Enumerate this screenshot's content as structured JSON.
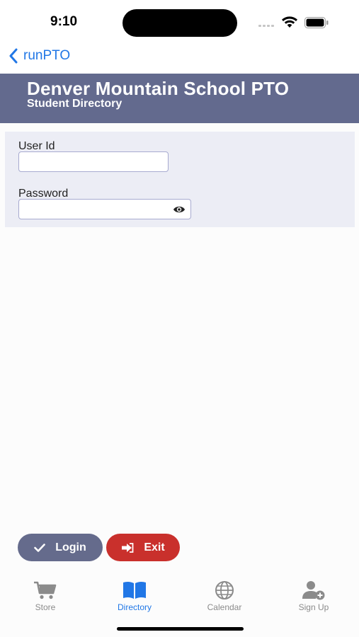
{
  "status_bar": {
    "time": "9:10"
  },
  "nav": {
    "back_label": "runPTO"
  },
  "header": {
    "title": "Denver Mountain School PTO",
    "subtitle": "Student Directory"
  },
  "form": {
    "user_id_label": "User Id",
    "user_id_value": "",
    "password_label": "Password",
    "password_value": ""
  },
  "actions": {
    "login_label": "Login",
    "exit_label": "Exit"
  },
  "colors": {
    "header_bg": "#636a8e",
    "login_bg": "#656b8c",
    "exit_bg": "#c9302c",
    "accent": "#2177e6"
  },
  "tab_bar": {
    "tabs": [
      {
        "label": "Store",
        "icon": "cart-icon",
        "active": false
      },
      {
        "label": "Directory",
        "icon": "book-icon",
        "active": true
      },
      {
        "label": "Calendar",
        "icon": "globe-icon",
        "active": false
      },
      {
        "label": "Sign Up",
        "icon": "user-plus-icon",
        "active": false
      }
    ]
  }
}
